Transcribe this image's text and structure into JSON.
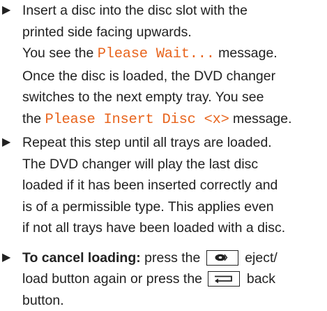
{
  "steps": [
    {
      "lines": [
        "Insert a disc into the disc slot with the",
        "printed side facing upwards."
      ],
      "msg1_pre": "You see the ",
      "msg1": "Please Wait...",
      "msg1_post": " message.",
      "lines2": [
        "Once the disc is loaded, the DVD changer",
        "switches to the next empty tray. You see"
      ],
      "msg2_pre": "the ",
      "msg2": "Please Insert Disc <x>",
      "msg2_post": " message."
    },
    {
      "lines": [
        "Repeat this step until all trays are loaded.",
        "The DVD changer will play the last disc",
        "loaded if it has been inserted correctly and",
        "is of a permissible type. This applies even",
        "if not all trays have been loaded with a disc."
      ]
    },
    {
      "bold_label": "To cancel loading:",
      "text_a": " press the ",
      "text_b": " eject/",
      "text_c": "load button again or press the ",
      "text_d": " back",
      "text_e": "button."
    }
  ],
  "icons": {
    "bullet": "right-triangle-icon",
    "eject_key": "eject-button-icon",
    "back_key": "back-button-icon"
  },
  "colors": {
    "message": "#e8651e",
    "text": "#222222"
  }
}
